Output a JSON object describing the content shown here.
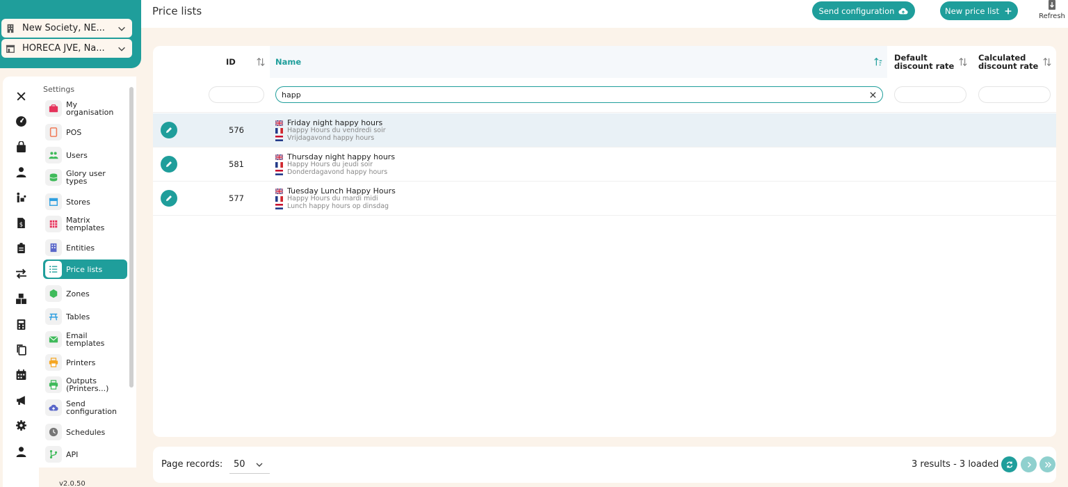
{
  "header": {
    "page_title": "Price lists",
    "send_configuration_label": "Send configuration",
    "new_price_list_label": "New price list",
    "refresh_label": "Refresh"
  },
  "selectors": {
    "society": "New Society, NE...",
    "store": "HORECA JVE, Na..."
  },
  "menu": {
    "section_title": "Settings",
    "items": [
      {
        "label": "My organisation",
        "icon": "briefcase-icon",
        "color": "#e5335b"
      },
      {
        "label": "POS",
        "icon": "tablet-icon",
        "color": "#f07c5a"
      },
      {
        "label": "Users",
        "icon": "users-icon",
        "color": "#3fba5a"
      },
      {
        "label": "Glory user types",
        "icon": "coins-icon",
        "color": "#3fba5a"
      },
      {
        "label": "Stores",
        "icon": "store-icon",
        "color": "#2f9fe0"
      },
      {
        "label": "Matrix templates",
        "icon": "grid-icon",
        "color": "#e5335b"
      },
      {
        "label": "Entities",
        "icon": "building-icon",
        "color": "#5a67c9"
      },
      {
        "label": "Price lists",
        "icon": "list-icon",
        "color": "#1f9e9b"
      },
      {
        "label": "Zones",
        "icon": "hexagon-icon",
        "color": "#3fba5a"
      },
      {
        "label": "Tables",
        "icon": "picnic-table-icon",
        "color": "#2f9fe0"
      },
      {
        "label": "Email templates",
        "icon": "envelope-icon",
        "color": "#3fba5a"
      },
      {
        "label": "Printers",
        "icon": "printer-icon",
        "color": "#f5a623"
      },
      {
        "label": "Outputs (Printers...)",
        "icon": "printer-icon",
        "color": "#3fba5a"
      },
      {
        "label": "Send configuration",
        "icon": "cloud-upload-icon",
        "color": "#5a67c9"
      },
      {
        "label": "Schedules",
        "icon": "clock-icon",
        "color": "#777777"
      },
      {
        "label": "API",
        "icon": "branch-icon",
        "color": "#3fba5a"
      }
    ]
  },
  "version": "v2.0.50",
  "table": {
    "columns": {
      "id": "ID",
      "name": "Name",
      "default_discount": "Default discount rate",
      "calculated_discount": "Calculated discount rate"
    },
    "filters": {
      "id": "",
      "name": "happ",
      "default_discount": "",
      "calculated_discount": ""
    },
    "rows": [
      {
        "id": "576",
        "en": "Friday night happy hours",
        "fr": "Happy Hours du vendredi soir",
        "nl": "Vrijdagavond happy hours"
      },
      {
        "id": "581",
        "en": "Thursday night happy hours",
        "fr": "Happy Hours du jeudi soir",
        "nl": "Donderdagavond happy hours"
      },
      {
        "id": "577",
        "en": "Tuesday Lunch Happy Hours",
        "fr": "Happy Hours du mardi midi",
        "nl": "Lunch happy hours op dinsdag"
      }
    ]
  },
  "footer": {
    "page_records_label": "Page records:",
    "page_records_value": "50",
    "results_text": "3 results - 3 loaded"
  },
  "colors": {
    "accent": "#1f9e9b",
    "background": "#fbf3ea"
  }
}
